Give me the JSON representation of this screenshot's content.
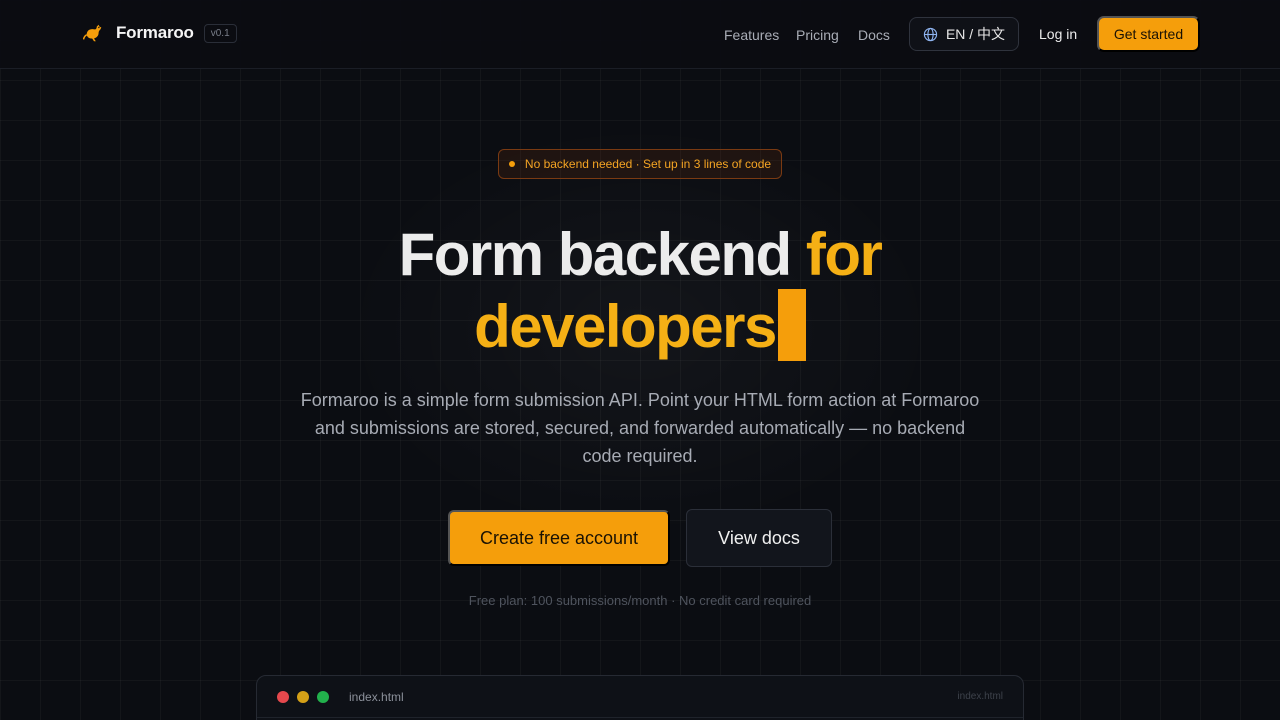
{
  "header": {
    "brand_name": "Formaroo",
    "version": "v0.1",
    "nav": [
      {
        "label": "Features"
      },
      {
        "label": "Pricing"
      },
      {
        "label": "Docs"
      }
    ],
    "language_label": "EN / 中文",
    "login_label": "Log in",
    "cta_label": "Get started"
  },
  "hero": {
    "badge_text": "No backend needed · Set up in 3 lines of code",
    "headline_white": "Form backend",
    "headline_amber_1": "for",
    "headline_amber_2": "developers",
    "subtitle": "Formaroo is a simple form submission API. Point your HTML form action at Formaroo and submissions are stored, secured, and forwarded automatically — no backend code required.",
    "primary_button": "Create free account",
    "secondary_button": "View docs",
    "footnote": "Free plan: 100 submissions/month · No credit card required"
  },
  "code_window": {
    "title": "index.html",
    "title_right": "index.html"
  },
  "colors": {
    "accent": "#f59e0b",
    "background": "#0b0d12",
    "dot_red": "#e5484d",
    "dot_yellow": "#d4a017",
    "dot_green": "#22b14c"
  },
  "icons": {
    "logo": "kangaroo-logo-icon",
    "language": "globe-icon"
  }
}
